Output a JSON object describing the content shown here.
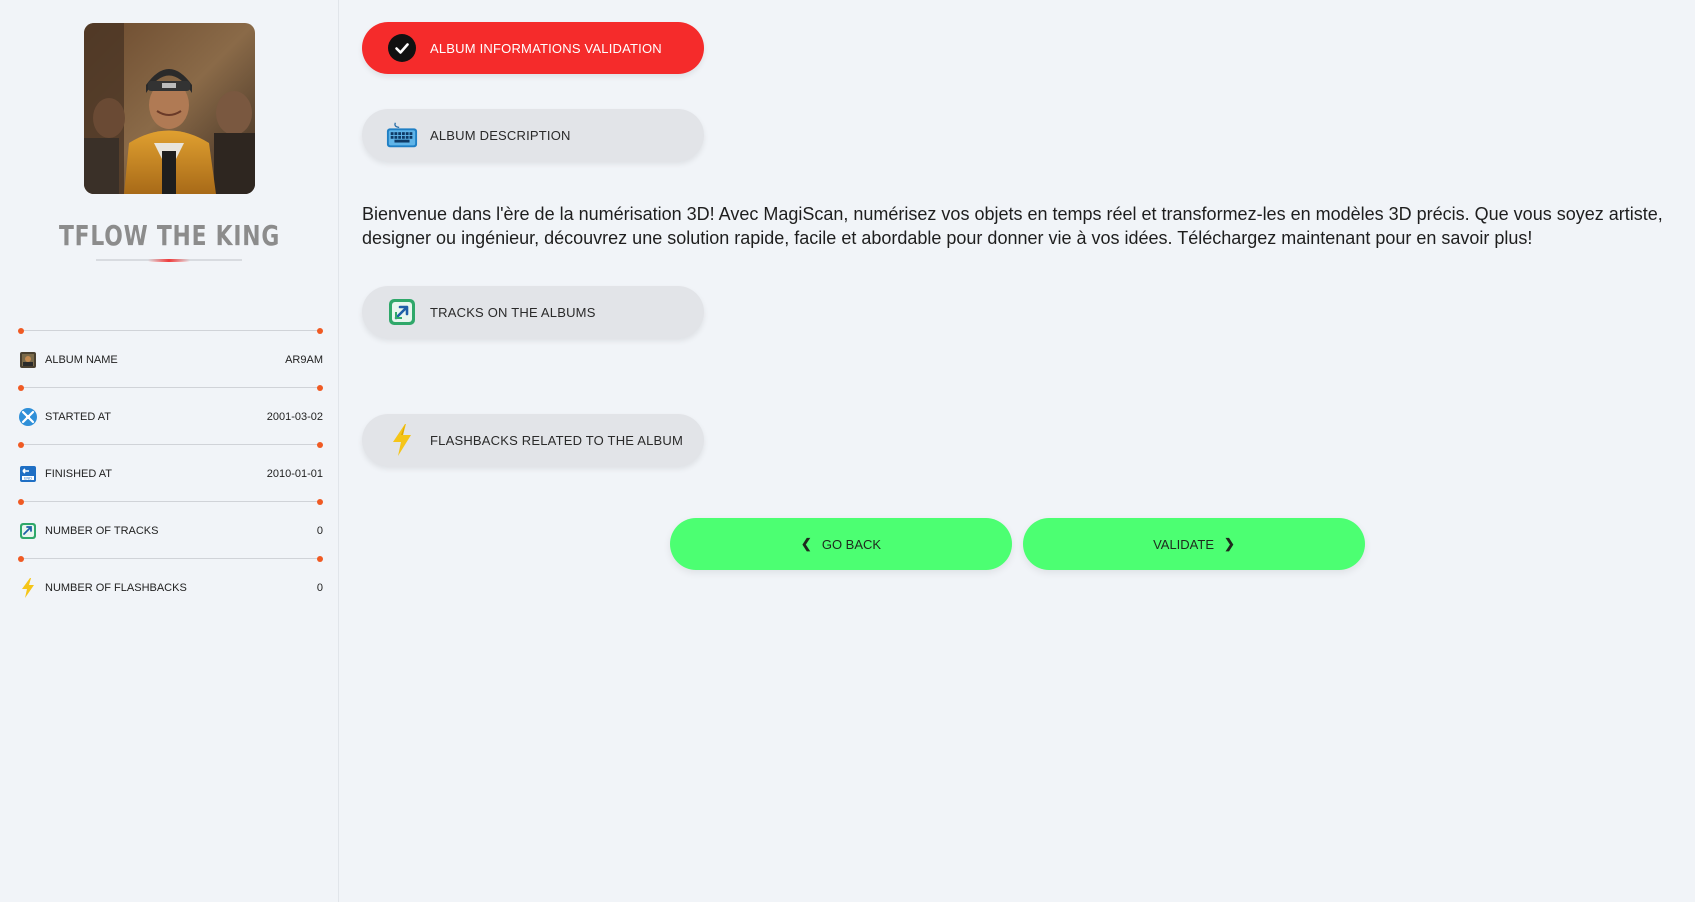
{
  "sidebar": {
    "avatar_icon": "album-cover-photo",
    "artist_name": "TFLOW THE KING",
    "info": [
      {
        "icon": "album-cover-icon",
        "label": "ALBUM NAME",
        "value": "AR9AM"
      },
      {
        "icon": "start-icon",
        "label": "STARTED AT",
        "value": "2001-03-02"
      },
      {
        "icon": "end-icon",
        "label": "FINISHED AT",
        "value": "2010-01-01"
      },
      {
        "icon": "tracks-icon",
        "label": "NUMBER OF TRACKS",
        "value": "0"
      },
      {
        "icon": "lightning-icon",
        "label": "NUMBER OF FLASHBACKS",
        "value": "0"
      }
    ]
  },
  "steps": {
    "validation": {
      "label": "ALBUM INFORMATIONS VALIDATION",
      "icon": "checkmark-icon",
      "active": true
    },
    "description": {
      "label": "ALBUM DESCRIPTION",
      "icon": "keyboard-icon"
    },
    "tracks": {
      "label": "TRACKS ON THE ALBUMS",
      "icon": "tracks-icon"
    },
    "flashbacks": {
      "label": "FLASHBACKS RELATED TO THE ALBUM",
      "icon": "lightning-icon"
    }
  },
  "description_text": "Bienvenue dans l'ère de la numérisation 3D! Avec MagiScan, numérisez vos objets en temps réel et transformez-les en modèles 3D précis. Que vous soyez artiste, designer ou ingénieur, découvrez une solution rapide, facile et abordable pour donner vie à vos idées. Téléchargez maintenant pour en savoir plus!",
  "buttons": {
    "back": "GO BACK",
    "validate": "VALIDATE"
  },
  "colors": {
    "active_step": "#f52b2b",
    "action_button": "#4cff72",
    "divider_dot": "#f05a23",
    "background": "#f1f4f8"
  }
}
